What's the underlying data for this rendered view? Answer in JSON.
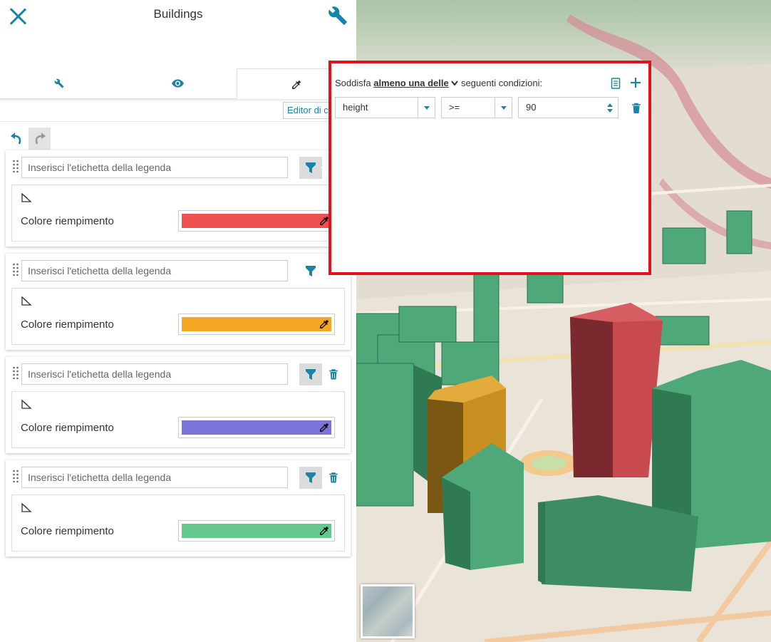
{
  "header": {
    "title": "Buildings"
  },
  "tabs": [
    {
      "name": "settings",
      "icon": "wrench-icon"
    },
    {
      "name": "display",
      "icon": "eye-icon"
    },
    {
      "name": "style",
      "icon": "dropper-icon",
      "active": true
    }
  ],
  "editor_link": "Editor di c",
  "rules": [
    {
      "placeholder": "Inserisci l'etichetta della legenda",
      "fill_label": "Colore riempimento",
      "color": "#f05050",
      "filter_active": true,
      "deletable": false
    },
    {
      "placeholder": "Inserisci l'etichetta della legenda",
      "fill_label": "Colore riempimento",
      "color": "#f5a623",
      "filter_active": false,
      "deletable": false
    },
    {
      "placeholder": "Inserisci l'etichetta della legenda",
      "fill_label": "Colore riempimento",
      "color": "#7c73db",
      "filter_active": true,
      "deletable": true
    },
    {
      "placeholder": "Inserisci l'etichetta della legenda",
      "fill_label": "Colore riempimento",
      "color": "#66c98d",
      "filter_active": true,
      "deletable": true
    }
  ],
  "filter_popup": {
    "prefix": "Soddisfa",
    "match_mode": "almeno una delle",
    "suffix": "seguenti condizioni:",
    "condition": {
      "attribute": "height",
      "operator": ">=",
      "value": "90"
    }
  },
  "colors": {
    "accent": "#1a84a6",
    "popup_border": "#e0121a",
    "building_green": "#4fa877",
    "building_red": "#b8383c",
    "building_orange": "#d19422"
  }
}
